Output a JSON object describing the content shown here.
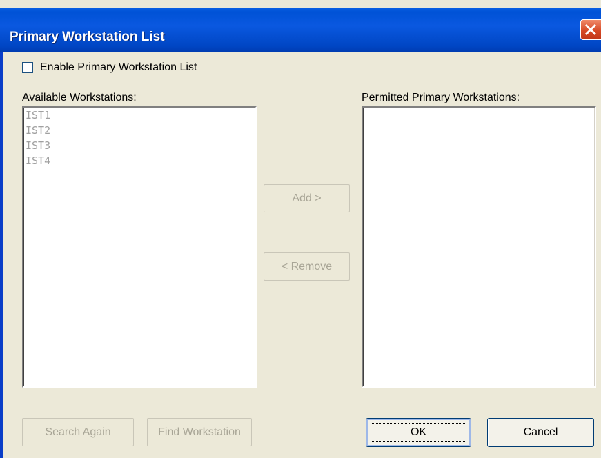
{
  "window": {
    "title": "Primary Workstation List",
    "close_icon": "close-icon"
  },
  "enable_checkbox": {
    "label": "Enable Primary Workstation List",
    "checked": false
  },
  "available": {
    "label": "Available Workstations:",
    "items": [
      "IST1",
      "IST2",
      "IST3",
      "IST4"
    ]
  },
  "permitted": {
    "label": "Permitted Primary Workstations:",
    "items": []
  },
  "buttons": {
    "add": "Add >",
    "remove": "< Remove",
    "search_again": "Search Again",
    "find_workstation": "Find Workstation",
    "ok": "OK",
    "cancel": "Cancel"
  },
  "colors": {
    "titlebar": "#0054e3",
    "window_bg": "#ece9d8",
    "close_button": "#d64a26",
    "disabled_text": "#a0a0a0"
  }
}
